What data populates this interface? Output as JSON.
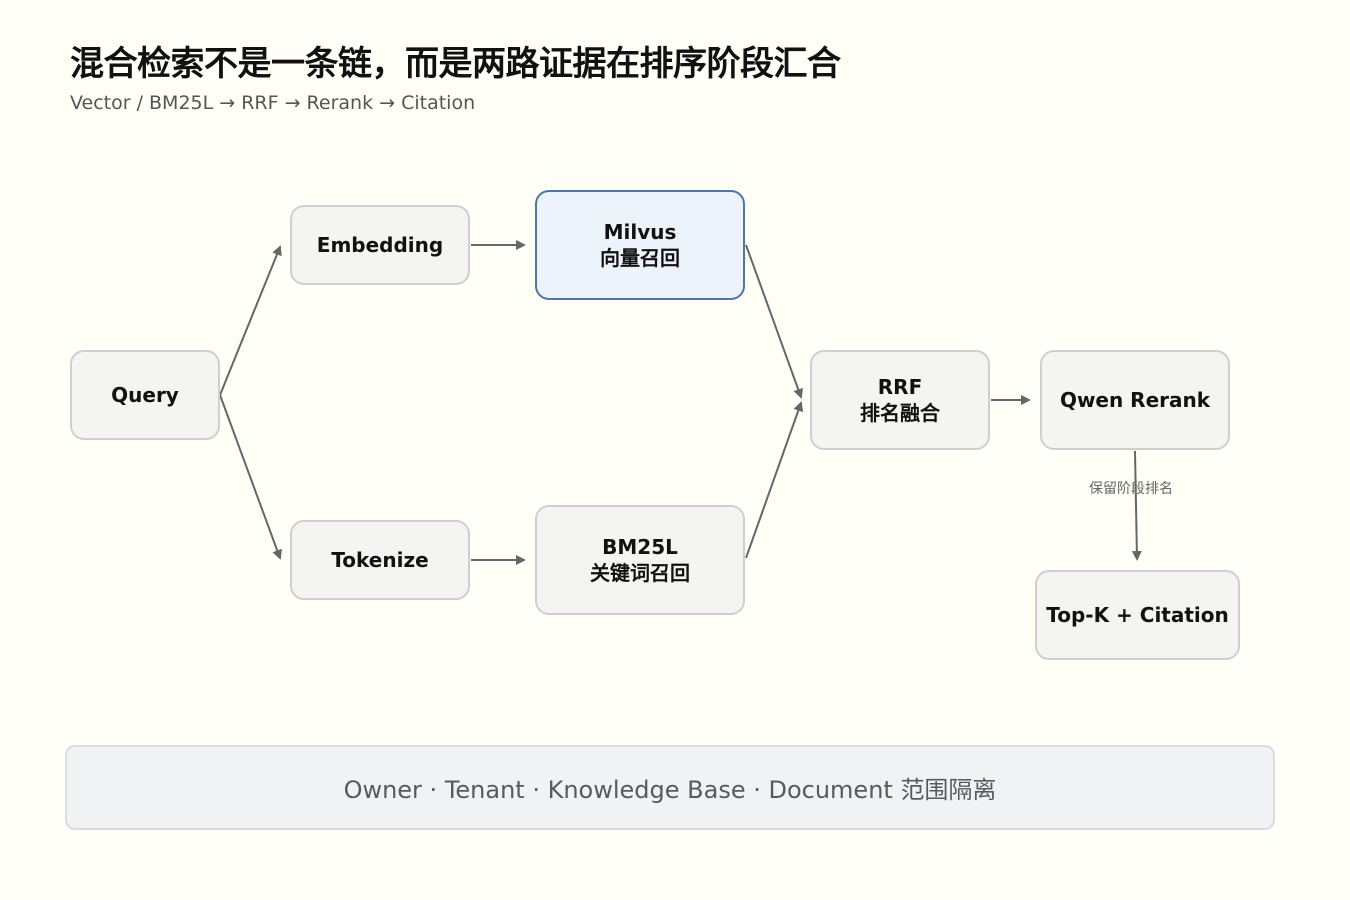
{
  "header": {
    "title": "混合检索不是一条链，而是两路证据在排序阶段汇合",
    "subtitle": "Vector / BM25L → RRF → Rerank → Citation"
  },
  "nodes": {
    "query": {
      "line1": "Query"
    },
    "embedding": {
      "line1": "Embedding"
    },
    "milvus": {
      "line1": "Milvus",
      "line2": "向量召回"
    },
    "tokenize": {
      "line1": "Tokenize"
    },
    "bm25l": {
      "line1": "BM25L",
      "line2": "关键词召回"
    },
    "rrf": {
      "line1": "RRF",
      "line2": "排名融合"
    },
    "rerank": {
      "line1": "Qwen Rerank"
    },
    "topk": {
      "line1": "Top-K + Citation"
    }
  },
  "edge_labels": {
    "rerank_to_topk": "保留阶段排名"
  },
  "footer": {
    "text": "Owner · Tenant · Knowledge Base · Document 范围隔离"
  },
  "colors": {
    "background": "#fffef7",
    "node_fill": "#f4f4f2",
    "node_border": "#cfcfcf",
    "highlight_fill": "#edf3fa",
    "highlight_border": "#4d77a8",
    "edge": "#666666"
  }
}
